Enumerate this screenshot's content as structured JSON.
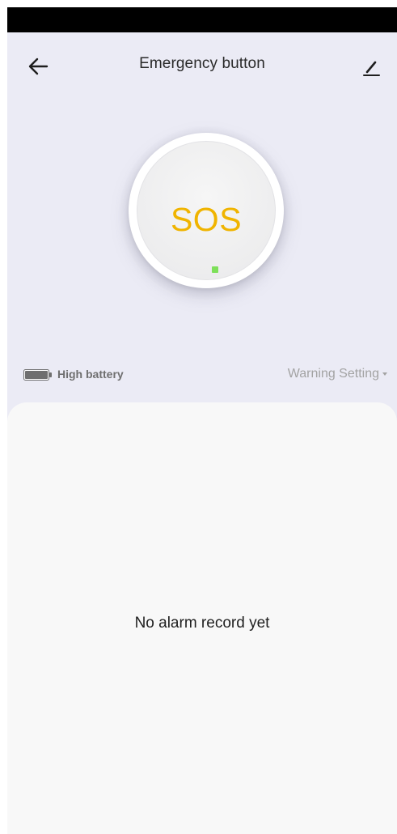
{
  "header": {
    "title": "Emergency button",
    "back_icon": "arrow-left-icon",
    "edit_icon": "pencil-edit-icon"
  },
  "sos": {
    "label": "SOS",
    "label_color": "#f0b400",
    "indicator_color": "#7ee05a"
  },
  "status": {
    "battery_icon": "battery-icon",
    "battery_label": "High battery",
    "warning_setting_label": "Warning Setting",
    "warning_setting_icon": "caret-down-icon"
  },
  "records": {
    "empty_message": "No alarm record yet"
  }
}
